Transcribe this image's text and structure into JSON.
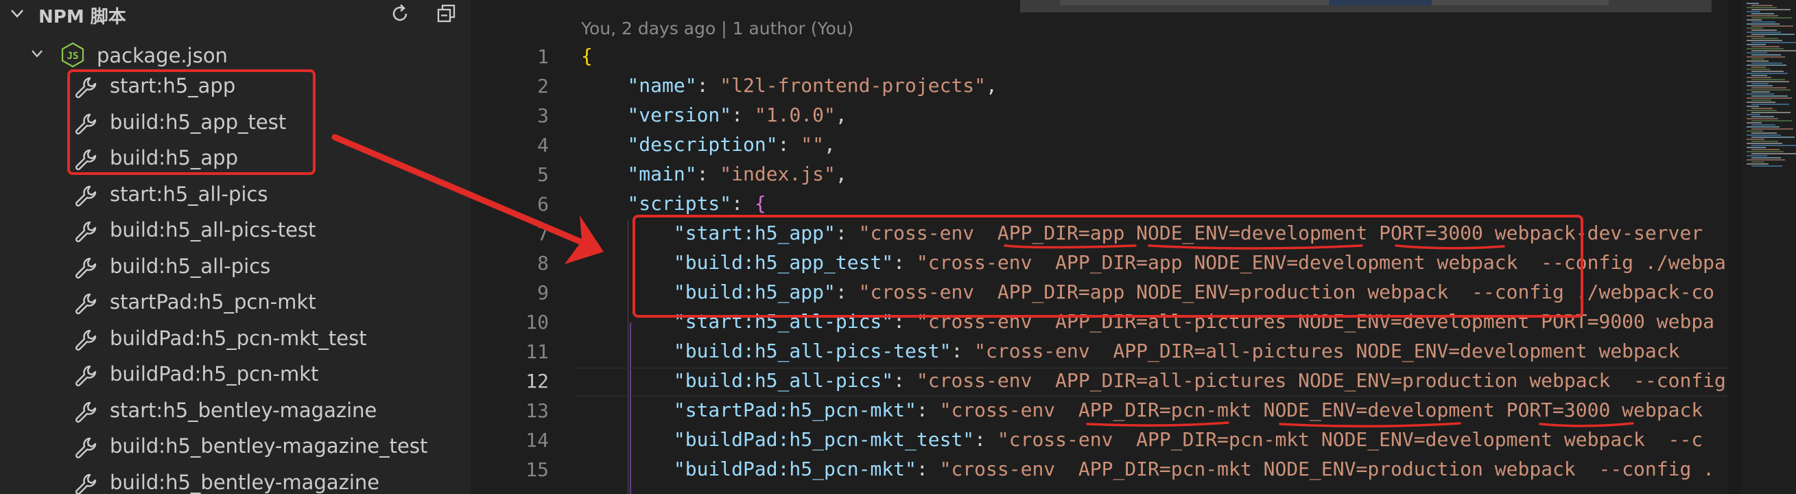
{
  "sidebar": {
    "title": "NPM 脚本",
    "package": "package.json",
    "scripts": [
      "start:h5_app",
      "build:h5_app_test",
      "build:h5_app",
      "start:h5_all-pics",
      "build:h5_all-pics-test",
      "build:h5_all-pics",
      "startPad:h5_pcn-mkt",
      "buildPad:h5_pcn-mkt_test",
      "buildPad:h5_pcn-mkt",
      "start:h5_bentley-magazine",
      "build:h5_bentley-magazine_test",
      "build:h5_bentley-magazine"
    ]
  },
  "editor": {
    "blame": "You, 2 days ago | 1 author (You)",
    "line_numbers": [
      "1",
      "2",
      "3",
      "4",
      "5",
      "6",
      "7",
      "8",
      "9",
      "10",
      "11",
      "12",
      "13",
      "14",
      "15"
    ],
    "lines": [
      [
        {
          "t": "{",
          "c": "brace"
        }
      ],
      [
        {
          "t": "    \"name\"",
          "c": "key"
        },
        {
          "t": ": ",
          "c": "punc"
        },
        {
          "t": "\"l2l-frontend-projects\"",
          "c": "str"
        },
        {
          "t": ",",
          "c": "punc"
        }
      ],
      [
        {
          "t": "    \"version\"",
          "c": "key"
        },
        {
          "t": ": ",
          "c": "punc"
        },
        {
          "t": "\"1.0.0\"",
          "c": "str"
        },
        {
          "t": ",",
          "c": "punc"
        }
      ],
      [
        {
          "t": "    \"description\"",
          "c": "key"
        },
        {
          "t": ": ",
          "c": "punc"
        },
        {
          "t": "\"\"",
          "c": "str"
        },
        {
          "t": ",",
          "c": "punc"
        }
      ],
      [
        {
          "t": "    \"main\"",
          "c": "key"
        },
        {
          "t": ": ",
          "c": "punc"
        },
        {
          "t": "\"index.js\"",
          "c": "str"
        },
        {
          "t": ",",
          "c": "punc"
        }
      ],
      [
        {
          "t": "    \"scripts\"",
          "c": "key"
        },
        {
          "t": ": ",
          "c": "punc"
        },
        {
          "t": "{",
          "c": "purple"
        }
      ],
      [
        {
          "t": "        \"start:h5_app\"",
          "c": "key"
        },
        {
          "t": ": ",
          "c": "punc"
        },
        {
          "t": "\"cross-env  APP_DIR=app NODE_ENV=development PORT=3000 webpack-dev-server",
          "c": "str"
        }
      ],
      [
        {
          "t": "        \"build:h5_app_test\"",
          "c": "key"
        },
        {
          "t": ": ",
          "c": "punc"
        },
        {
          "t": "\"cross-env  APP_DIR=app NODE_ENV=development webpack  --config ./webpa",
          "c": "str"
        }
      ],
      [
        {
          "t": "        \"build:h5_app\"",
          "c": "key"
        },
        {
          "t": ": ",
          "c": "punc"
        },
        {
          "t": "\"cross-env  APP_DIR=app NODE_ENV=production webpack  --config ./webpack-co",
          "c": "str"
        }
      ],
      [
        {
          "t": "        \"start:h5_all-pics\"",
          "c": "key"
        },
        {
          "t": ": ",
          "c": "punc"
        },
        {
          "t": "\"cross-env  APP_DIR=all-pictures NODE_ENV=development PORT=9000 webpa",
          "c": "str"
        }
      ],
      [
        {
          "t": "        \"build:h5_all-pics-test\"",
          "c": "key"
        },
        {
          "t": ": ",
          "c": "punc"
        },
        {
          "t": "\"cross-env  APP_DIR=all-pictures NODE_ENV=development webpack",
          "c": "str"
        }
      ],
      [
        {
          "t": "        \"build:h5_all-pics\"",
          "c": "key"
        },
        {
          "t": ": ",
          "c": "punc"
        },
        {
          "t": "\"cross-env  APP_DIR=all-pictures NODE_ENV=production webpack  --config",
          "c": "str"
        }
      ],
      [
        {
          "t": "        \"startPad:h5_pcn-mkt\"",
          "c": "key"
        },
        {
          "t": ": ",
          "c": "punc"
        },
        {
          "t": "\"cross-env  APP_DIR=pcn-mkt NODE_ENV=development PORT=3000 webpack",
          "c": "str"
        }
      ],
      [
        {
          "t": "        \"buildPad:h5_pcn-mkt_test\"",
          "c": "key"
        },
        {
          "t": ": ",
          "c": "punc"
        },
        {
          "t": "\"cross-env  APP_DIR=pcn-mkt NODE_ENV=development webpack  --c",
          "c": "str"
        }
      ],
      [
        {
          "t": "        \"buildPad:h5_pcn-mkt\"",
          "c": "key"
        },
        {
          "t": ": ",
          "c": "punc"
        },
        {
          "t": "\"cross-env  APP_DIR=pcn-mkt NODE_ENV=production webpack  --config .",
          "c": "str"
        }
      ]
    ]
  },
  "colors": {
    "annotation_red": "#e02b26",
    "json_key": "#9cdcfe",
    "json_string": "#ce9178",
    "brace": "#ffd700"
  }
}
